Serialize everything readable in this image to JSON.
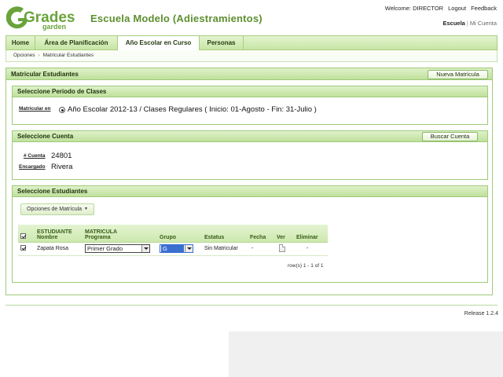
{
  "header": {
    "logo": {
      "word": "Grades",
      "sub": "garden"
    },
    "title": "Escuela Modelo (Adiestramientos)",
    "top_links": {
      "welcome": "Welcome: DIRECTOR",
      "logout": "Logout",
      "feedback": "Feedback"
    },
    "sub_links": {
      "escuela": "Escuela",
      "separator": "|",
      "mi_cuenta": "Mi Cuenta"
    }
  },
  "nav": {
    "tabs": [
      {
        "label": "Home"
      },
      {
        "label": "Área de Planificación"
      },
      {
        "label": "Año Escolar en Curso",
        "active": true
      },
      {
        "label": "Personas"
      }
    ]
  },
  "breadcrumb": {
    "items": [
      "Opciones",
      "Matricular Estudiantes"
    ],
    "separator": "›"
  },
  "main": {
    "title": "Matricular Estudiantes",
    "new_button": "Nueva Matrícula",
    "periodo": {
      "title": "Seleccione Periodo de Clases",
      "label": "Matricular en",
      "value": "Año Escolar 2012-13 / Clases Regulares ( Inicio: 01-Agosto - Fin: 31-Julio )"
    },
    "cuenta": {
      "title": "Seleccione Cuenta",
      "search_button": "Buscar Cuenta",
      "numero_label": "# Cuenta",
      "numero_value": "24801",
      "encargado_label": "Encargado",
      "encargado_value": "Rivera"
    },
    "estudiantes": {
      "title": "Seleccione Estudiantes",
      "options_button": "Opciones de Matrícula",
      "columns": {
        "estudiante": [
          "ESTUDIANTE",
          "Nombre"
        ],
        "matricula": [
          "MATRICULA",
          "Programa"
        ],
        "grupo": "Grupo",
        "estatus": "Estatus",
        "fecha": "Fecha",
        "ver": "Ver",
        "eliminar": "Eliminar"
      },
      "rows": [
        {
          "nombre": "Zapata Rosa",
          "programa": "Primer Grado",
          "grupo": "G",
          "estatus": "Sin Matricular",
          "fecha": "-",
          "eliminar": "-"
        }
      ],
      "rows_info": "row(s) 1 - 1 of 1"
    }
  },
  "footer": {
    "release": "Release 1.2.4"
  },
  "colors": {
    "brand_green": "#5e8f2f",
    "header_green": "#c7e6a5",
    "border_green": "#9fcb7a"
  }
}
